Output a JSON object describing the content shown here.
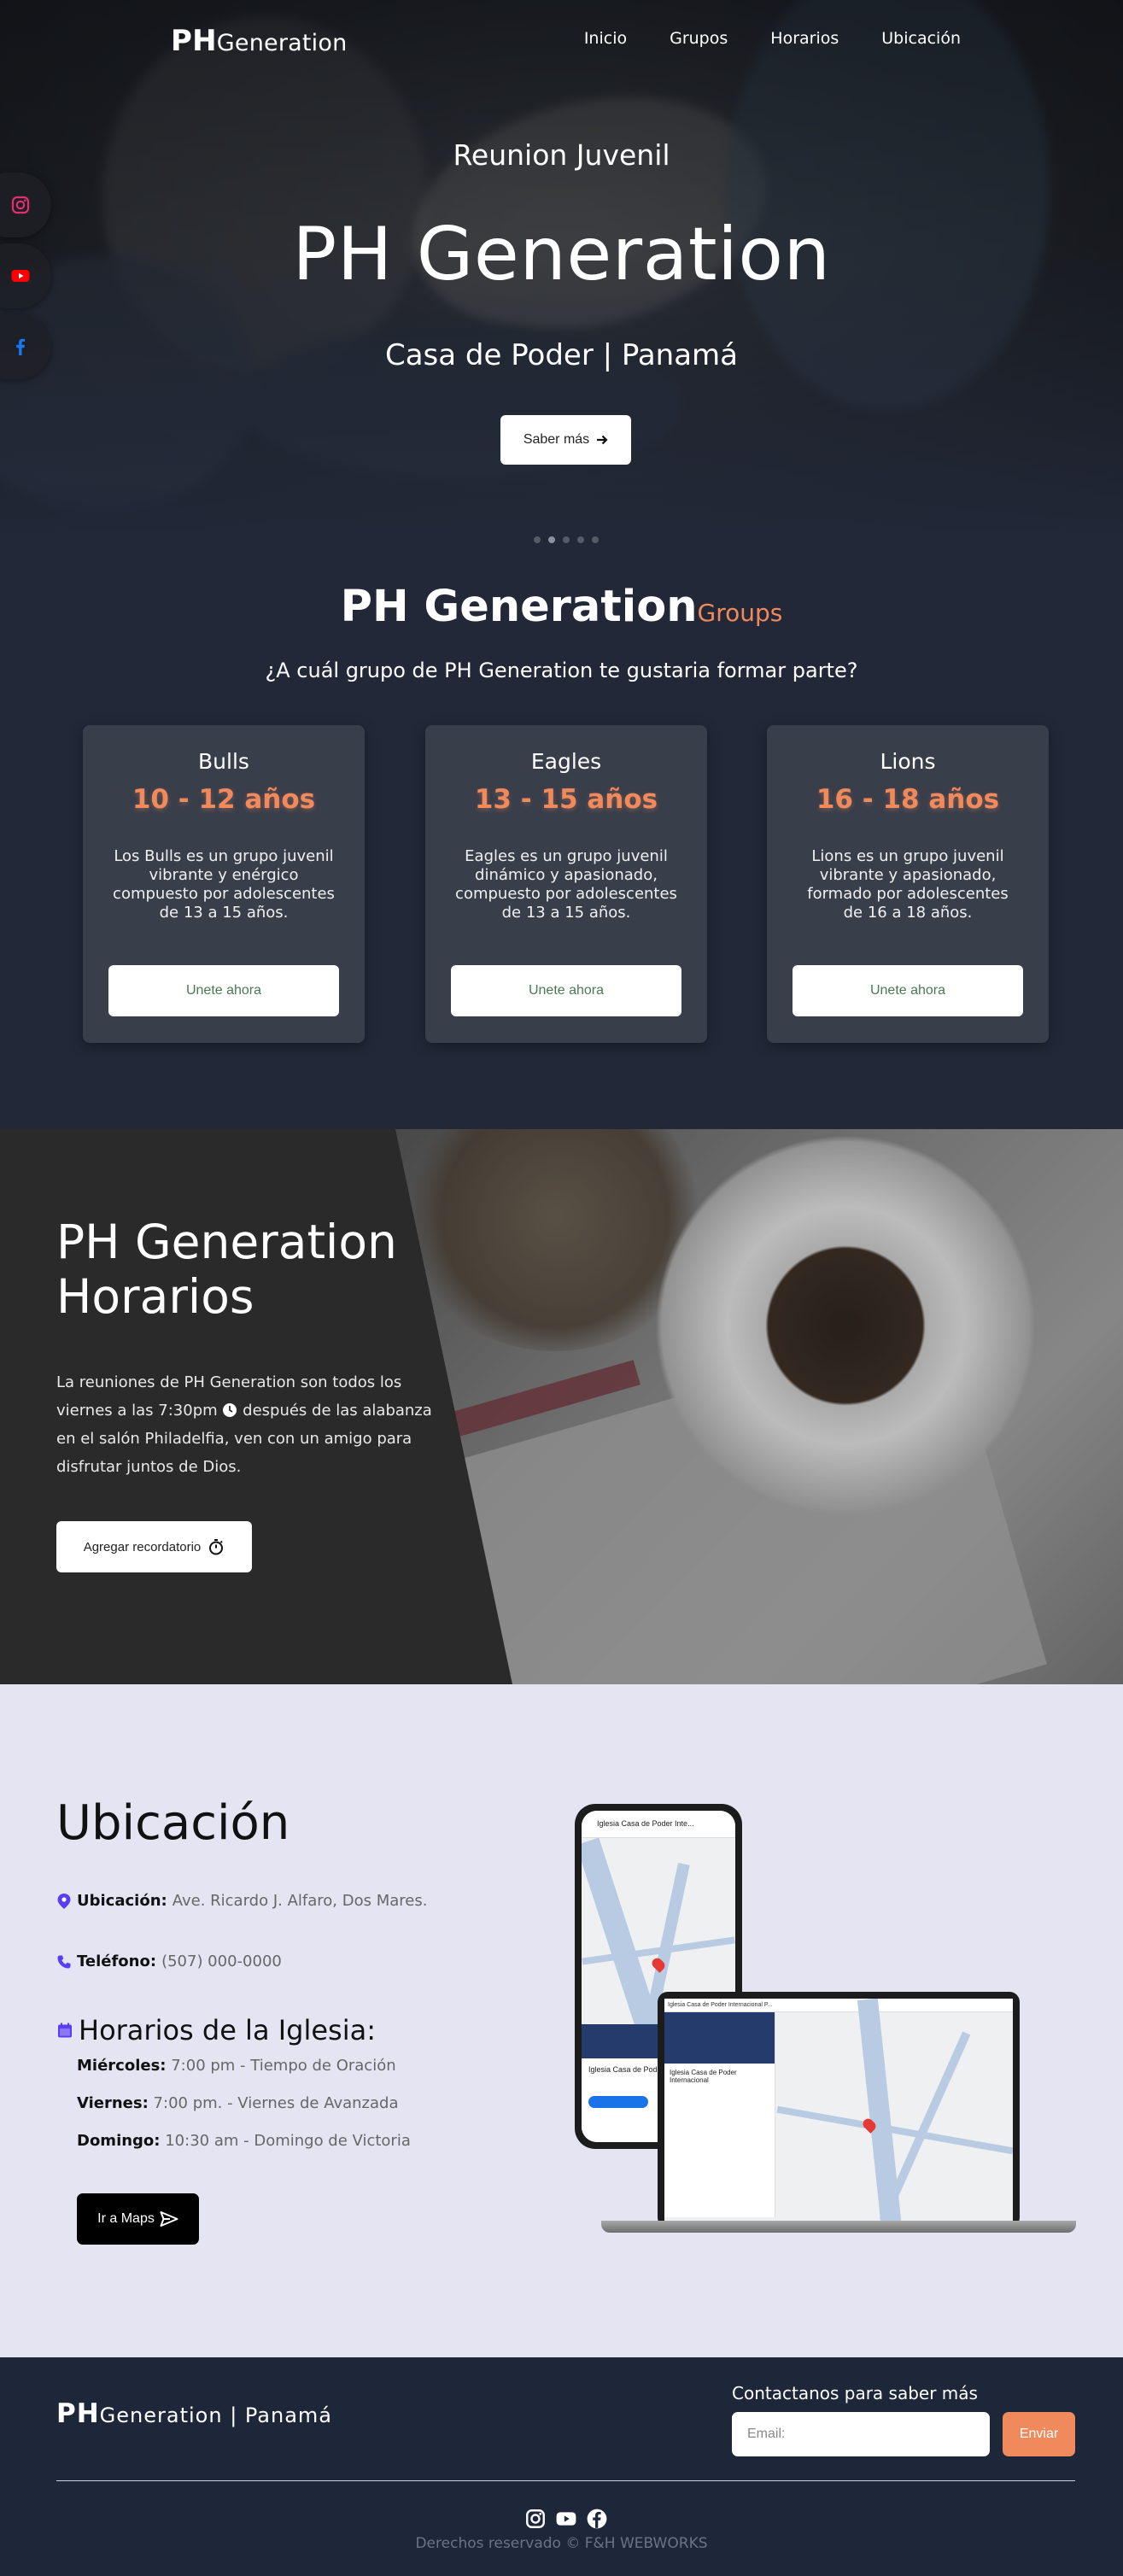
{
  "brand": {
    "strong": "PH",
    "rest": "Generation"
  },
  "nav": {
    "items": [
      "Inicio",
      "Grupos",
      "Horarios",
      "Ubicación"
    ]
  },
  "social": [
    "instagram-icon",
    "youtube-icon",
    "facebook-icon"
  ],
  "hero": {
    "kicker": "Reunion Juvenil",
    "title": "PH Generation",
    "subtitle": "Casa de Poder | Panamá",
    "cta": "Saber más"
  },
  "groups": {
    "title": "PH Generation",
    "title_suffix": "Groups",
    "question": "¿A cuál grupo de PH Generation te gustaria formar parte?",
    "cards": [
      {
        "name": "Bulls",
        "age": "10 - 12 años",
        "desc": "Los Bulls es un grupo juvenil vibrante y enérgico compuesto por adolescentes de 13 a 15 años.",
        "cta": "Unete ahora"
      },
      {
        "name": "Eagles",
        "age": "13 - 15 años",
        "desc": "Eagles es un grupo juvenil dinámico y apasionado, compuesto por adolescentes de 13 a 15 años.",
        "cta": "Unete ahora"
      },
      {
        "name": "Lions",
        "age": "16 - 18 años",
        "desc": "Lions es un grupo juvenil vibrante y apasionado, formado por adolescentes de 16 a 18 años.",
        "cta": "Unete ahora"
      }
    ]
  },
  "schedule": {
    "title_line1": "PH Generation",
    "title_line2": "Horarios",
    "text_before": "La reuniones de PH Generation son todos los viernes a las 7:30pm",
    "text_after": "después de las alabanza en el salón Philadelfia, ven con un amigo para disfrutar juntos de Dios.",
    "cta": "Agregar recordatorio"
  },
  "location": {
    "title": "Ubicación",
    "address_label": "Ubicación:",
    "address": "Ave. Ricardo J. Alfaro, Dos Mares.",
    "phone_label": "Teléfono:",
    "phone": "(507) 000-0000",
    "hours_title": "Horarios de la Iglesia:",
    "days": [
      {
        "day": "Miércoles:",
        "time": "7:00 pm - Tiempo de Oración"
      },
      {
        "day": "Viernes:",
        "time": "7:00 pm. - Viernes de Avanzada"
      },
      {
        "day": "Domingo:",
        "time": "10:30 am - Domingo de Victoria"
      }
    ],
    "cta": "Ir a Maps",
    "phone_search": "Iglesia Casa de Poder Inte...",
    "phone_place": "Iglesia Casa de Poder...",
    "laptop_search": "Iglesia Casa de Poder Internacional P...",
    "laptop_place": "Iglesia Casa de Poder Internacional"
  },
  "footer": {
    "brand_strong": "PH",
    "brand_rest": "Generation | Panamá",
    "contact": "Contactanos para saber más",
    "email_placeholder": "Email:",
    "send": "Enviar",
    "copyright": "Derechos reservado © F&H WEBWORKS"
  },
  "colors": {
    "accent": "#f08a5d",
    "dark": "#222838",
    "footer": "#1e2639",
    "location_bg": "#e5e4f3"
  }
}
